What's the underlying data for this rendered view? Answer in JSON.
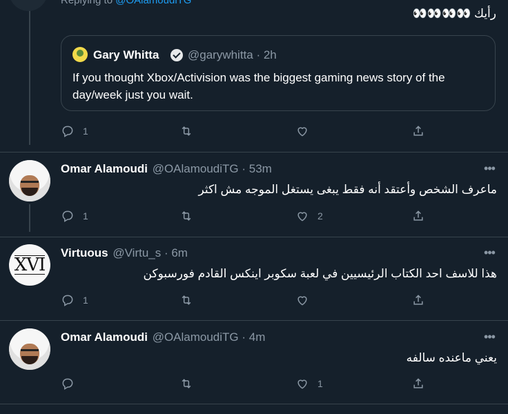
{
  "top_reply": {
    "replying_prefix": "Replying to",
    "replying_handle": "@OAlamoudiTG",
    "text": "رأيك 👀👀👀👀"
  },
  "quote": {
    "name": "Gary Whitta",
    "handle_time": "@garywhitta · 2h",
    "text": "If you thought Xbox/Activision was the biggest gaming news story of the day/week just you wait."
  },
  "tweets": [
    {
      "actions": {
        "replies": "1",
        "retweets": "",
        "likes": ""
      }
    },
    {
      "name": "Omar Alamoudi",
      "meta": "@OAlamoudiTG · 53m",
      "text": "ماعرف الشخص وأعتقد أنه فقط يبغى يستغل الموجه مش اكثر",
      "actions": {
        "replies": "1",
        "retweets": "",
        "likes": "2"
      }
    },
    {
      "name": "Virtuous",
      "meta": "@Virtu_s · 6m",
      "avatar_text": "XVI",
      "text": "هذا للاسف احد الكتاب الرئيسيين في لعبة سكوبر اينكس القادم فورسبوكن",
      "actions": {
        "replies": "1",
        "retweets": "",
        "likes": ""
      }
    },
    {
      "name": "Omar Alamoudi",
      "meta": "@OAlamoudiTG · 4m",
      "text": "يعني ماعنده سالفه",
      "actions": {
        "replies": "",
        "retweets": "",
        "likes": "1"
      }
    }
  ],
  "colors": {
    "background": "#15202b",
    "text_primary": "#ffffff",
    "text_secondary": "#8b98a5",
    "link": "#1d9bf0",
    "border": "#38444d"
  },
  "icons": [
    "reply-icon",
    "retweet-icon",
    "like-icon",
    "share-icon",
    "more-icon",
    "verified-icon"
  ]
}
